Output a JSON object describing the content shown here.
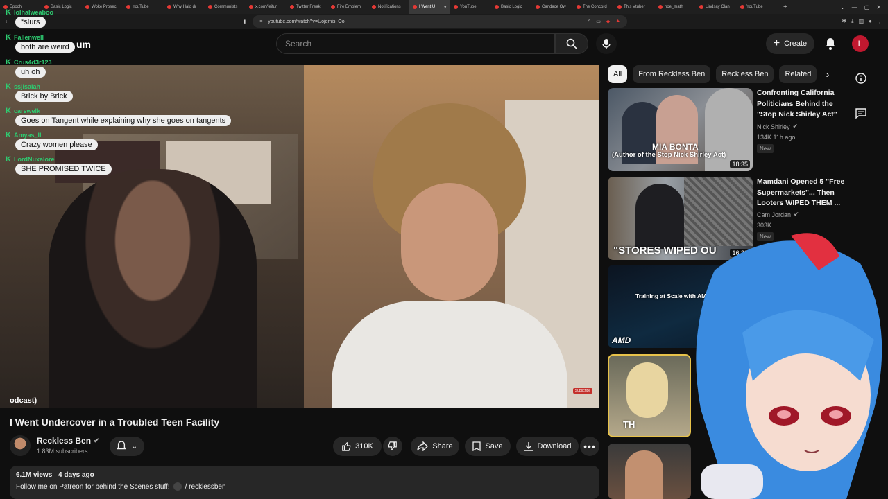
{
  "browser": {
    "tabs": [
      "Epoch",
      "Basic Logic",
      "Woke Prosec",
      "YouTube",
      "Why Halo dr",
      "Communists",
      "x.com/feifun",
      "Twitter Freak",
      "Fire Emblem",
      "Notifications",
      "I Went U",
      "YouTube",
      "Basic Logic",
      "Candace Ow",
      "The Concord",
      "This Vtuber",
      "hoe_math",
      "Lindsay Clan",
      "YouTube"
    ],
    "active_tab_index": 10,
    "url": "youtube.com/watch?v=Uojqmis_Oo"
  },
  "header": {
    "logo_text": "um",
    "search_placeholder": "Search",
    "create_label": "Create",
    "user_initial": "L"
  },
  "chat": [
    {
      "user": "lolhalweaboo",
      "message": "*slurs"
    },
    {
      "user": "Fallenwell",
      "message": "both are weird"
    },
    {
      "user": "Crus4d3r123",
      "message": "uh oh"
    },
    {
      "user": "ssjisaiah",
      "message": "Brick by Brick"
    },
    {
      "user": "carswelk",
      "message": "Goes on Tangent while explaining why she goes on tangents"
    },
    {
      "user": "Amyas_II",
      "message": "Crazy women please"
    },
    {
      "user": "LordNuxalore",
      "message": "SHE PROMISED TWICE"
    }
  ],
  "video": {
    "overlay_caption": "odcast)",
    "subscribe_watermark": "Subscribe",
    "title": "I Went Undercover in a Troubled Teen Facility",
    "channel": "Reckless Ben",
    "subscribers": "1.83M subscribers",
    "likes": "310K",
    "share_label": "Share",
    "save_label": "Save",
    "download_label": "Download",
    "views": "6.1M views",
    "age": "4 days ago",
    "description": "Follow me on Patreon for behind the Scenes stuff!",
    "description_link": "/ recklessben"
  },
  "chips": [
    "All",
    "From Reckless Ben",
    "Reckless Ben",
    "Related"
  ],
  "recommendations": [
    {
      "title": "Confronting California Politicians Behind the \"Stop Nick Shirley Act\"",
      "channel": "Nick Shirley",
      "meta": "134K  11h ago",
      "badge": "New",
      "duration": "18:35",
      "thumb_text": "MIA BONTA",
      "thumb_sub": "(Author of the Stop Nick Shirley Act)"
    },
    {
      "title": "Mamdani Opened 5 \"Free Supermarkets\"... Then Looters WIPED THEM ...",
      "channel": "Cam Jordan",
      "meta": "303K",
      "badge": "New",
      "duration": "16:23",
      "thumb_text": "\"STORES WIPED OU"
    },
    {
      "thumb_text": "Training at Scale with AMD",
      "logo": "AMD"
    },
    {
      "thumb_text": "TH"
    }
  ],
  "colors": {
    "accent": "#ff0000",
    "chat_user": "#2ecc71",
    "avatar": "#c0182f"
  }
}
